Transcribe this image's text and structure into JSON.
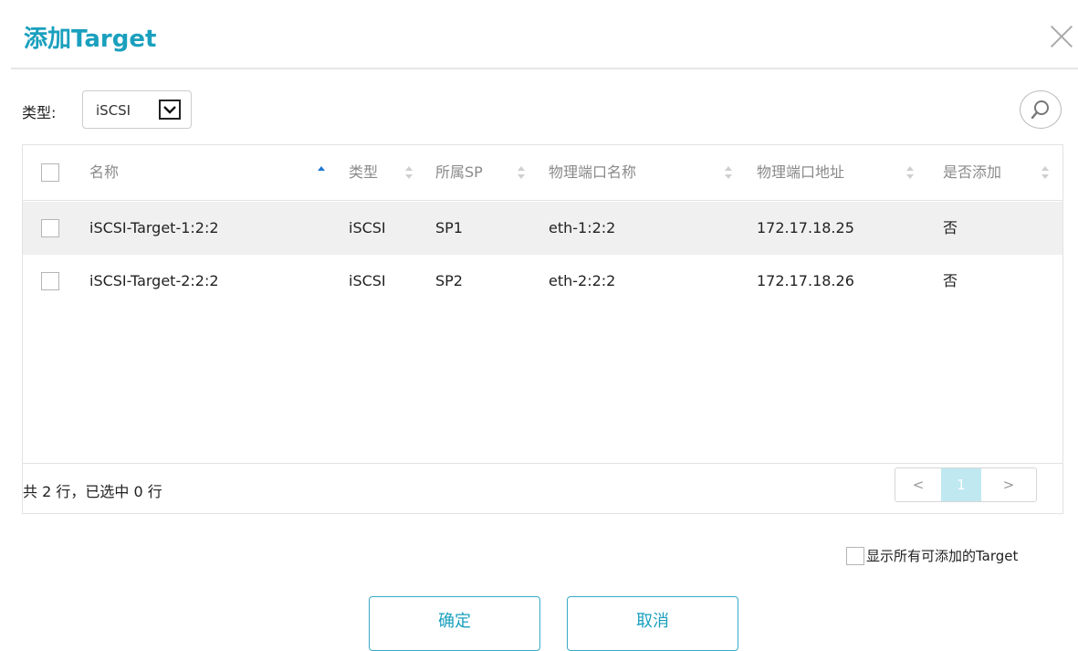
{
  "dialog": {
    "title": "添加Target"
  },
  "filter": {
    "label": "类型:",
    "type_value": "iSCSI"
  },
  "table": {
    "columns": [
      "名称",
      "类型",
      "所属SP",
      "物理端口名称",
      "物理端口地址",
      "是否添加"
    ],
    "rows": [
      [
        "iSCSI-Target-1:2:2",
        "iSCSI",
        "SP1",
        "eth-1:2:2",
        "172.17.18.25",
        "否"
      ],
      [
        "iSCSI-Target-2:2:2",
        "iSCSI",
        "SP2",
        "eth-2:2:2",
        "172.17.18.26",
        "否"
      ]
    ],
    "summary": "共 2 行，已选中 0 行"
  },
  "pagination": {
    "prev": "<",
    "current": "1",
    "next": ">"
  },
  "options": {
    "show_all_label": "显示所有可添加的Target"
  },
  "buttons": {
    "ok": "确定",
    "cancel": "取消"
  },
  "colors": {
    "accent": "#1aa0be",
    "row_highlight": "#f0f0f0",
    "page_active": "#bfe8f1"
  }
}
